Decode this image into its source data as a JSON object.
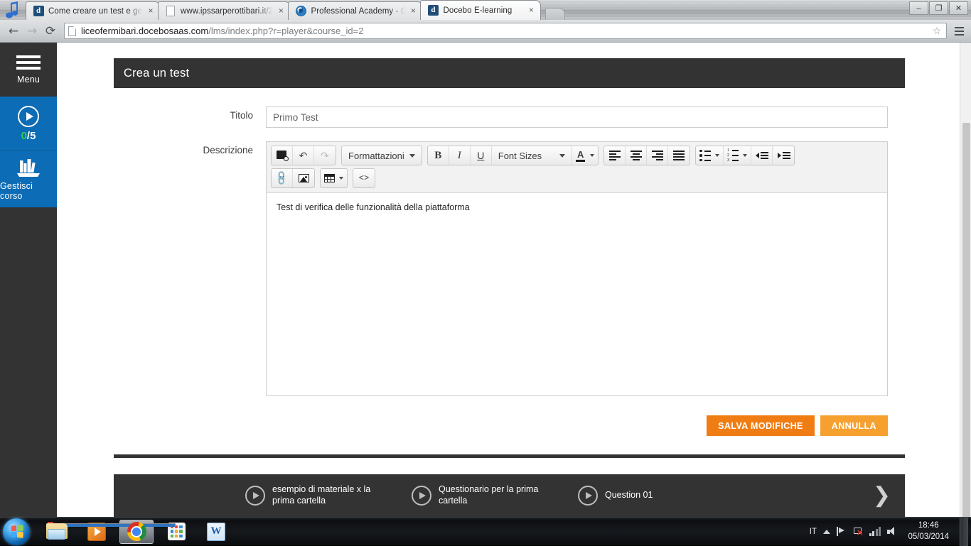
{
  "browser": {
    "tabs": [
      {
        "title": "Come creare un test e ges",
        "favicon": "docebo-d-icon",
        "active": false,
        "close_label": "×"
      },
      {
        "title": "www.ipssarperottibari.it/2",
        "favicon": "page-icon",
        "active": false,
        "close_label": "×"
      },
      {
        "title": "Professional Academy - C",
        "favicon": "circle-blue-icon",
        "active": false,
        "close_label": "×"
      },
      {
        "title": "Docebo E-learning",
        "favicon": "docebo-d-icon",
        "active": true,
        "close_label": "×"
      }
    ],
    "window_controls": {
      "minimize": "–",
      "maximize": "❐",
      "close": "✕"
    },
    "nav": {
      "back": "←",
      "forward": "→",
      "reload": "⟳"
    },
    "url_domain": "liceofermibari.docebosaas.com",
    "url_path": "/lms/index.php?r=player&course_id=2",
    "star": "☆"
  },
  "sidebar": {
    "menu_label": "Menu",
    "progress": {
      "completed": "0",
      "separator": "/",
      "total": "5"
    },
    "manage_label": "Gestisci corso"
  },
  "card": {
    "title": "Crea un test",
    "fields": {
      "titolo_label": "Titolo",
      "titolo_value": "Primo Test",
      "descrizione_label": "Descrizione"
    },
    "editor": {
      "toolbar_row1": [
        {
          "name": "preview-icon",
          "label": ""
        },
        {
          "name": "undo-icon",
          "label": "↶"
        },
        {
          "name": "redo-icon",
          "label": "↷"
        },
        {
          "name": "formats-dropdown",
          "label": "Formattazioni"
        },
        {
          "name": "bold-icon",
          "label": "B"
        },
        {
          "name": "italic-icon",
          "label": "I"
        },
        {
          "name": "underline-icon",
          "label": "U"
        },
        {
          "name": "font-sizes-dropdown",
          "label": "Font Sizes"
        },
        {
          "name": "text-color-icon",
          "label": "A"
        },
        {
          "name": "align-left-icon",
          "label": ""
        },
        {
          "name": "align-center-icon",
          "label": ""
        },
        {
          "name": "align-right-icon",
          "label": ""
        },
        {
          "name": "align-justify-icon",
          "label": ""
        },
        {
          "name": "bullet-list-icon",
          "label": ""
        },
        {
          "name": "numbered-list-icon",
          "label": ""
        },
        {
          "name": "outdent-icon",
          "label": ""
        },
        {
          "name": "indent-icon",
          "label": ""
        }
      ],
      "toolbar_row2": [
        {
          "name": "link-icon",
          "label": "🔗"
        },
        {
          "name": "image-icon",
          "label": ""
        },
        {
          "name": "table-icon",
          "label": ""
        },
        {
          "name": "source-code-icon",
          "label": "<>"
        }
      ],
      "formats_label": "Formattazioni",
      "font_sizes_label": "Font Sizes",
      "source_code_label": "<>",
      "content": "Test di verifica delle funzionalità della piattaforma"
    },
    "buttons": {
      "save_label": "SALVA MODIFICHE",
      "cancel_label": "ANNULLA"
    },
    "colors": {
      "save_bg": "#f07d14",
      "cancel_bg": "#f6a02f",
      "header_bg": "#333333",
      "sidebar_accent": "#0c6cb5",
      "progress_done": "#33cc55"
    }
  },
  "bottom_nav": {
    "items": [
      {
        "label": "esempio di materiale x la prima cartella"
      },
      {
        "label": "Questionario per la prima cartella"
      },
      {
        "label": "Question 01"
      }
    ],
    "next_label": "❯"
  },
  "taskbar": {
    "items": [
      {
        "name": "taskbar-explorer",
        "active": false
      },
      {
        "name": "taskbar-media-player",
        "active": false
      },
      {
        "name": "taskbar-chrome",
        "active": true
      },
      {
        "name": "taskbar-apps",
        "active": false
      },
      {
        "name": "taskbar-word",
        "active": false
      }
    ],
    "tray": {
      "language": "IT",
      "time": "18:46",
      "date": "05/03/2014"
    }
  }
}
